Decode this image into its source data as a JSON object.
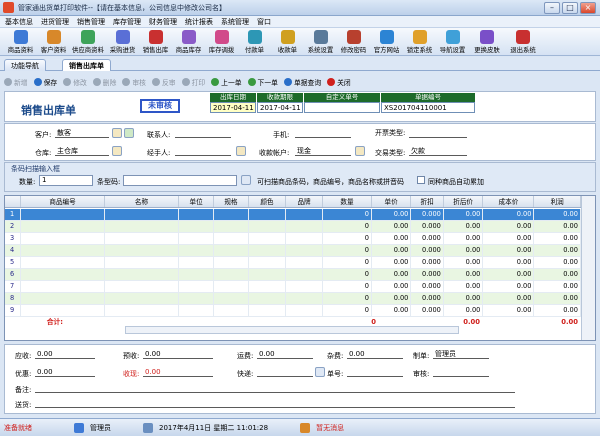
{
  "window": {
    "title": "管家通出货单打印软件--【请在基本信息，公司信息中修改公司名】"
  },
  "menu": [
    "基本信息",
    "进货管理",
    "销售管理",
    "库存管理",
    "财务管理",
    "统计报表",
    "系统管理",
    "窗口"
  ],
  "toolbar": [
    {
      "label": "商品资料",
      "icon": "goods-icon",
      "color": "#3e7ad6"
    },
    {
      "label": "客户资料",
      "icon": "customer-icon",
      "color": "#d8882a"
    },
    {
      "label": "供应商资料",
      "icon": "supplier-icon",
      "color": "#3ea35a"
    },
    {
      "label": "采购进货",
      "icon": "purchase-icon",
      "color": "#5a6fd6"
    },
    {
      "label": "销售出库",
      "icon": "sales-out-icon",
      "color": "#c93030"
    },
    {
      "label": "商品库存",
      "icon": "inventory-icon",
      "color": "#8a5bc8"
    },
    {
      "label": "库存调拨",
      "icon": "transfer-icon",
      "color": "#d14a8a"
    },
    {
      "label": "付款单",
      "icon": "payment-icon",
      "color": "#2d97b5"
    },
    {
      "label": "收款单",
      "icon": "receipt-icon",
      "color": "#d0a020"
    },
    {
      "label": "系统设置",
      "icon": "settings-icon",
      "color": "#5a7a9a"
    },
    {
      "label": "修改密码",
      "icon": "password-icon",
      "color": "#b8402e"
    },
    {
      "label": "官方网站",
      "icon": "website-icon",
      "color": "#2c84d4"
    },
    {
      "label": "锁定系统",
      "icon": "lock-icon",
      "color": "#e0a02a"
    },
    {
      "label": "导航设置",
      "icon": "nav-settings-icon",
      "color": "#3fa0d8"
    },
    {
      "label": "更换皮肤",
      "icon": "skin-icon",
      "color": "#7a4fc8"
    },
    {
      "label": "退出系统",
      "icon": "exit-icon",
      "color": "#c83030"
    }
  ],
  "tabs": [
    {
      "label": "功能导航"
    },
    {
      "label": "销售出库单"
    }
  ],
  "subtoolbar": [
    {
      "label": "新增",
      "color": "#9aa8b8",
      "disabled": true
    },
    {
      "label": "保存",
      "color": "#2a6fc9",
      "disabled": false
    },
    {
      "label": "修改",
      "color": "#9aa8b8",
      "disabled": true
    },
    {
      "label": "删除",
      "color": "#9aa8b8",
      "disabled": true
    },
    {
      "label": "审核",
      "color": "#9aa8b8",
      "disabled": true
    },
    {
      "label": "反审",
      "color": "#9aa8b8",
      "disabled": true
    },
    {
      "label": "打印",
      "color": "#9aa8b8",
      "disabled": true
    },
    {
      "label": "上一单",
      "color": "#3a9a40",
      "disabled": false
    },
    {
      "label": "下一单",
      "color": "#3a9a40",
      "disabled": false
    },
    {
      "label": "单据查询",
      "color": "#2a6fc9",
      "disabled": false
    },
    {
      "label": "关闭",
      "color": "#d0201c",
      "disabled": false
    }
  ],
  "doc": {
    "title": "销售出库单",
    "stamp": "未审核",
    "h_date": "出库日期",
    "v_date": "2017-04-11",
    "h_due": "收款期限",
    "v_due": "2017-04-11",
    "h_custom": "自定义单号",
    "v_custom": "",
    "h_no": "单据编号",
    "v_no": "XS201704110001"
  },
  "form": {
    "customer_label": "客户:",
    "customer_value": "散客",
    "contact_label": "联系人:",
    "contact_value": "",
    "phone_label": "手机:",
    "phone_value": "",
    "invoice_label": "开票类型:",
    "invoice_value": "",
    "warehouse_label": "仓库:",
    "warehouse_value": "主仓库",
    "handler_label": "经手人:",
    "handler_value": "",
    "account_label": "收款帐户:",
    "account_value": "现金",
    "trade_label": "交易类型:",
    "trade_value": "欠款"
  },
  "scan": {
    "caption": "条码扫描输入框",
    "qty_label": "数量:",
    "qty_value": "1",
    "barcode_label": "条型码:",
    "hint": "可扫描商品条码，商品编号，商品名称或拼音码",
    "checkbox_label": "同种商品自动累加"
  },
  "grid": {
    "columns": [
      "",
      "商品编号",
      "名称",
      "单位",
      "规格",
      "颜色",
      "品牌",
      "数量",
      "单价",
      "折扣",
      "折后价",
      "成本价",
      "利润"
    ],
    "rows": [
      {
        "n": "1",
        "qty": "0",
        "price": "0.00",
        "disc": "0.000",
        "after": "0.00",
        "cost": "0.00",
        "profit": "0.00"
      },
      {
        "n": "2",
        "qty": "0",
        "price": "0.00",
        "disc": "0.000",
        "after": "0.00",
        "cost": "0.00",
        "profit": "0.00"
      },
      {
        "n": "3",
        "qty": "0",
        "price": "0.00",
        "disc": "0.000",
        "after": "0.00",
        "cost": "0.00",
        "profit": "0.00"
      },
      {
        "n": "4",
        "qty": "0",
        "price": "0.00",
        "disc": "0.000",
        "after": "0.00",
        "cost": "0.00",
        "profit": "0.00"
      },
      {
        "n": "5",
        "qty": "0",
        "price": "0.00",
        "disc": "0.000",
        "after": "0.00",
        "cost": "0.00",
        "profit": "0.00"
      },
      {
        "n": "6",
        "qty": "0",
        "price": "0.00",
        "disc": "0.000",
        "after": "0.00",
        "cost": "0.00",
        "profit": "0.00"
      },
      {
        "n": "7",
        "qty": "0",
        "price": "0.00",
        "disc": "0.000",
        "after": "0.00",
        "cost": "0.00",
        "profit": "0.00"
      },
      {
        "n": "8",
        "qty": "0",
        "price": "0.00",
        "disc": "0.000",
        "after": "0.00",
        "cost": "0.00",
        "profit": "0.00"
      },
      {
        "n": "9",
        "qty": "0",
        "price": "0.00",
        "disc": "0.000",
        "after": "0.00",
        "cost": "0.00",
        "profit": "0.00"
      }
    ],
    "total_label": "合计:",
    "total_qty": "0",
    "total_after": "0.00",
    "total_profit": "0.00"
  },
  "footer": {
    "receivable_label": "应收:",
    "receivable_value": "0.00",
    "prepaid_label": "预收:",
    "prepaid_value": "0.00",
    "freight_label": "运费:",
    "freight_value": "0.00",
    "misc_label": "杂费:",
    "misc_value": "0.00",
    "maker_label": "制单:",
    "maker_value": "管理员",
    "discount_label": "优惠:",
    "discount_value": "0.00",
    "received_label": "收现:",
    "received_value": "0.00",
    "express_label": "快递:",
    "express_value": "",
    "tracking_label": "单号:",
    "tracking_value": "",
    "auditor_label": "审核:",
    "auditor_value": "",
    "remark_label": "备注:",
    "address_label": "送货:"
  },
  "status": {
    "ready": "准备就绪",
    "user": "管理员",
    "datetime": "2017年4月11日 星期二 11:01:28",
    "message": "暂无消息"
  }
}
